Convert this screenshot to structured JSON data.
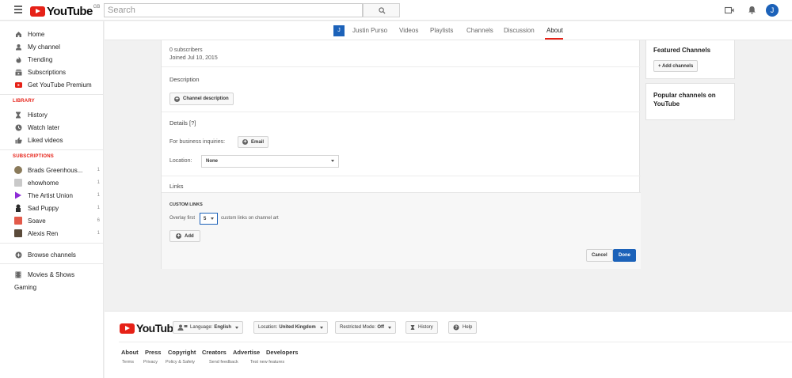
{
  "header": {
    "logo_text": "YouTube",
    "logo_region": "GB",
    "search_placeholder": "Search",
    "avatar_letter": "J",
    "brand_color": "#e62117",
    "accent_color": "#1c62b9"
  },
  "sidebar": {
    "main": [
      {
        "label": "Home",
        "icon": "home-icon"
      },
      {
        "label": "My channel",
        "icon": "person-icon"
      },
      {
        "label": "Trending",
        "icon": "flame-icon"
      },
      {
        "label": "Subscriptions",
        "icon": "subscriptions-icon"
      },
      {
        "label": "Get YouTube Premium",
        "icon": "youtube-premium-icon"
      }
    ],
    "library_heading": "LIBRARY",
    "library": [
      {
        "label": "History",
        "icon": "hourglass-icon"
      },
      {
        "label": "Watch later",
        "icon": "clock-icon"
      },
      {
        "label": "Liked videos",
        "icon": "thumbs-up-icon"
      }
    ],
    "subscriptions_heading": "SUBSCRIPTIONS",
    "subscriptions": [
      {
        "label": "Brads Greenhous...",
        "count": "1",
        "color": "#8a7a5a"
      },
      {
        "label": "ehowhome",
        "count": "1",
        "color": "#c9c9c9"
      },
      {
        "label": "The Artist Union",
        "count": "1",
        "color": "#8d2bd6"
      },
      {
        "label": "Sad Puppy",
        "count": "1",
        "color": "#2b2b2b"
      },
      {
        "label": "Soave",
        "count": "6",
        "color": "#e35a4a"
      },
      {
        "label": "Alexis Ren",
        "count": "1",
        "color": "#5a4a3a"
      }
    ],
    "browse_channels": "Browse channels",
    "more": [
      {
        "label": "Movies & Shows",
        "icon": "film-icon"
      },
      {
        "label": "Gaming",
        "icon": ""
      }
    ]
  },
  "channel_tabs": {
    "avatar_letter": "J",
    "tabs": [
      "Justin Purso",
      "Videos",
      "Playlists",
      "Channels",
      "Discussion",
      "About"
    ],
    "active": "About"
  },
  "about": {
    "subscribers": "0 subscribers",
    "joined": "Joined Jul 10, 2015",
    "description_heading": "Description",
    "channel_description_btn": "Channel description",
    "details_heading": "Details [?]",
    "business_label": "For business inquiries:",
    "email_btn": "Email",
    "location_label": "Location:",
    "location_value": "None",
    "links_heading": "Links",
    "custom_links_heading": "CUSTOM LINKS",
    "overlay_prefix": "Overlay first",
    "overlay_value": "5",
    "overlay_suffix": "custom links on channel art",
    "add_btn": "Add",
    "cancel_btn": "Cancel",
    "done_btn": "Done"
  },
  "right": {
    "featured_title": "Featured Channels",
    "add_channels_btn": "+ Add channels",
    "popular_title": "Popular channels on YouTube"
  },
  "footer": {
    "logo_text": "YouTube",
    "language_label": "Language:",
    "language_value": "English",
    "location_label": "Location:",
    "location_value": "United Kingdom",
    "restricted_label": "Restricted Mode:",
    "restricted_value": "Off",
    "history_btn": "History",
    "help_btn": "Help",
    "links": [
      "About",
      "Press",
      "Copyright",
      "Creators",
      "Advertise",
      "Developers"
    ],
    "small_links": [
      "Terms",
      "Privacy",
      "Policy & Safety",
      "Send feedback",
      "Test new features"
    ]
  }
}
